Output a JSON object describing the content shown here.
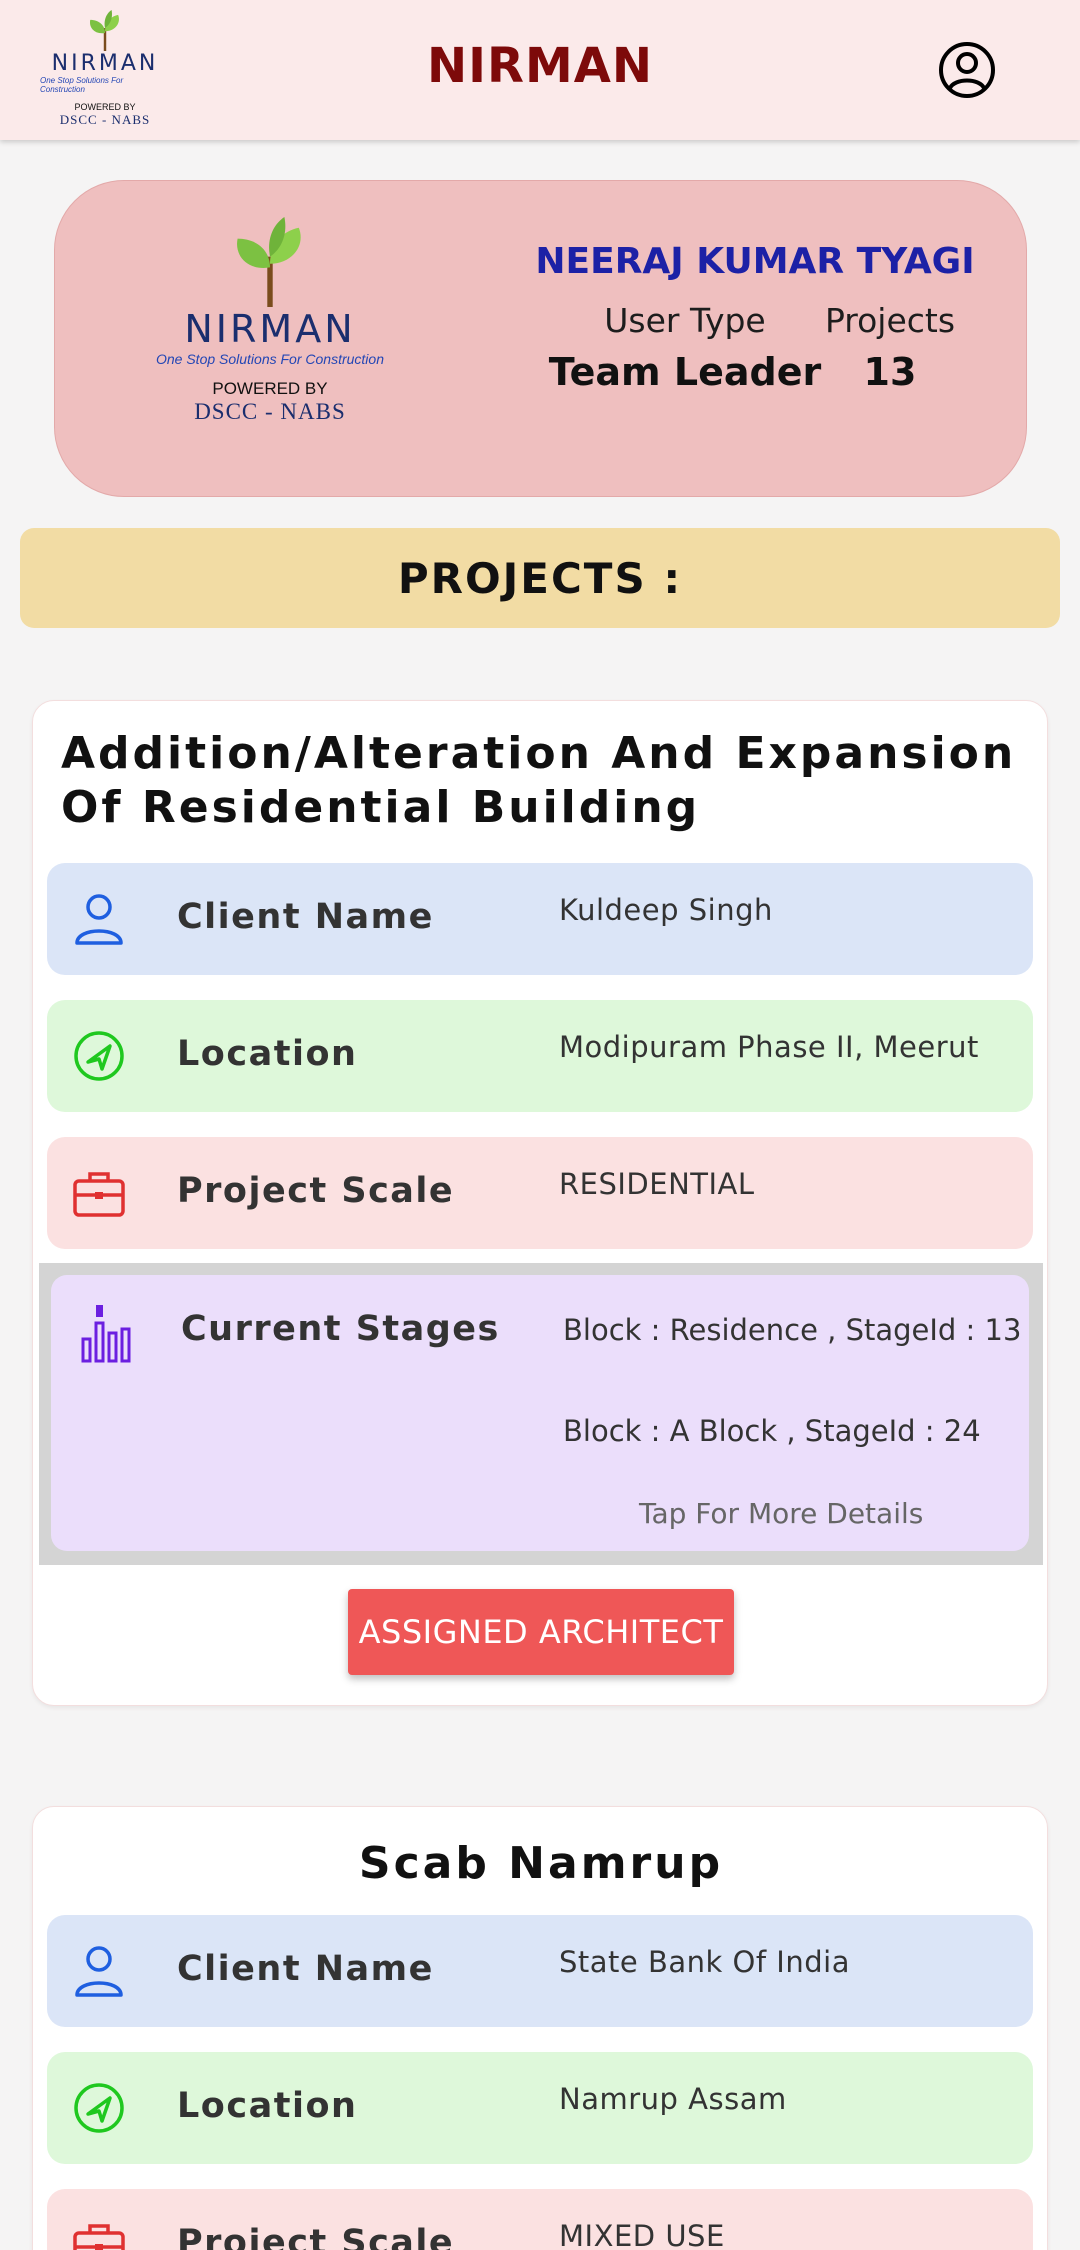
{
  "app": {
    "title": "NIRMAN"
  },
  "logo": {
    "word": "NIRMAN",
    "tagline": "One Stop Solutions For Construction",
    "powered_by": "POWERED BY",
    "org": "DSCC - NABS"
  },
  "user": {
    "name": "NEERAJ KUMAR TYAGI",
    "user_type_label": "User Type",
    "user_type": "Team Leader",
    "projects_label": "Projects",
    "projects_count": "13"
  },
  "section_title": "PROJECTS :",
  "projects": [
    {
      "title": "Addition/Alteration And Expansion Of Residential Building",
      "client_label": "Client Name",
      "client": "Kuldeep Singh",
      "location_label": "Location",
      "location": "Modipuram Phase  II, Meerut",
      "scale_label": "Project Scale",
      "scale": "RESIDENTIAL",
      "stages_label": "Current Stages",
      "stages": [
        "Block : Residence , StageId : 13",
        "Block : A Block , StageId : 24"
      ],
      "tap_hint": "Tap For More Details",
      "button_label": "ASSIGNED ARCHITECT"
    },
    {
      "title": "Scab Namrup",
      "client_label": "Client Name",
      "client": "State Bank Of India",
      "location_label": "Location",
      "location": "Namrup Assam",
      "scale_label": "Project Scale",
      "scale": "MIXED USE"
    }
  ],
  "colors": {
    "appbar_bg": "#fbeaea",
    "title": "#7d0a0a",
    "name": "#1c21a6",
    "profile_card": "#efbfbf",
    "banner": "#f2dca4",
    "client_row": "#dbe5f7",
    "location_row": "#def8da",
    "scale_row": "#fbe1e1",
    "stages_row": "#ebdefb",
    "button": "#ef5757"
  },
  "icons": {
    "profile": "account-circle-icon",
    "client": "person-icon",
    "location": "navigation-icon",
    "scale": "briefcase-icon",
    "stages": "bar-chart-icon"
  }
}
